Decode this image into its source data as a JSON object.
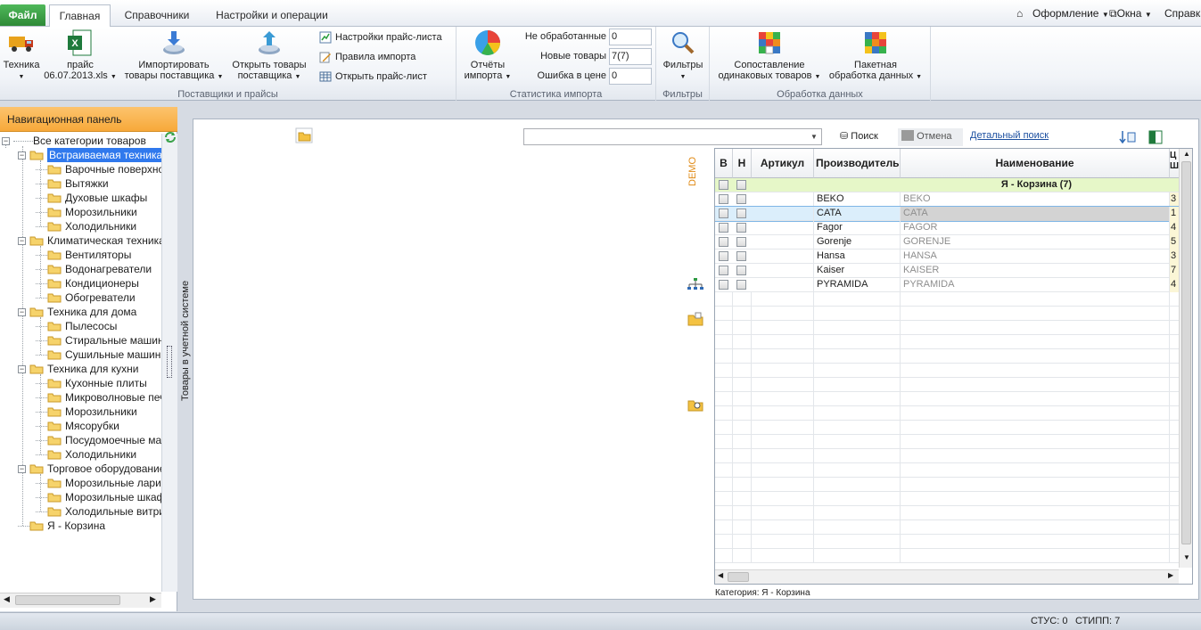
{
  "ribbon_tabs": {
    "file": "Файл",
    "home": "Главная",
    "refs": "Справочники",
    "settings": "Настройки и операции"
  },
  "ribbon_top_right": {
    "design": "Оформление",
    "windows": "Окна",
    "help": "Справка"
  },
  "ribbon": {
    "suppliers": {
      "label": "Поставщики и прайсы",
      "tech": "Техника",
      "price_line1": "прайс",
      "price_line2": "06.07.2013.xls",
      "import_line1": "Импортировать",
      "import_line2": "товары поставщика",
      "open_line1": "Открыть товары",
      "open_line2": "поставщика",
      "price_settings": "Настройки прайс-листа",
      "import_rules": "Правила импорта",
      "open_price": "Открыть прайс-лист"
    },
    "stats": {
      "label": "Статистика импорта",
      "reports_line1": "Отчёты",
      "reports_line2": "импорта",
      "not_processed_label": "Не обработанные",
      "not_processed_value": "0",
      "new_label": "Новые товары",
      "new_value": "7(7)",
      "errors_label": "Ошибка в цене",
      "errors_value": "0"
    },
    "filters": {
      "label": "Фильтры",
      "btn": "Фильтры"
    },
    "processing": {
      "label": "Обработка данных",
      "match_line1": "Сопоставление",
      "match_line2": "одинаковых товаров",
      "batch_line1": "Пакетная",
      "batch_line2": "обработка данных"
    }
  },
  "nav": {
    "title": "Навигационная панель",
    "root": "Все категории товаров",
    "items": [
      "Встраиваемая техника",
      "Варочные поверхности",
      "Вытяжки",
      "Духовые шкафы",
      "Морозильники",
      "Холодильники",
      "Климатическая техника",
      "Вентиляторы",
      "Водонагреватели",
      "Кондиционеры",
      "Обогреватели",
      "Техника для дома",
      "Пылесосы",
      "Стиральные машины",
      "Сушильные машины",
      "Техника для кухни",
      "Кухонные плиты",
      "Микроволновые печи",
      "Морозильники",
      "Мясорубки",
      "Посудомоечные машины",
      "Холодильники",
      "Торговое оборудование",
      "Морозильные лари",
      "Морозильные шкафы",
      "Холодильные витрины",
      "Я - Корзина"
    ]
  },
  "side_strip": "Товары в учетной системе",
  "main": {
    "search_btn": "Поиск",
    "cancel_btn": "Отмена",
    "detail_search": "Детальный поиск",
    "demo": "DEMO",
    "caption": "Категория: Я - Корзина"
  },
  "grid": {
    "headers": [
      "В",
      "Н",
      "Артикул",
      "Производитель",
      "Наименование",
      "Ц",
      "Ш"
    ],
    "group_row": "Я - Корзина (7)",
    "rows": [
      {
        "manufacturer": "BEKO",
        "name": "BEKO",
        "extra": "3"
      },
      {
        "manufacturer": "CATA",
        "name": "CATA",
        "extra": "1"
      },
      {
        "manufacturer": "Fagor",
        "name": "FAGOR",
        "extra": "4"
      },
      {
        "manufacturer": "Gorenje",
        "name": "GORENJE",
        "extra": "5"
      },
      {
        "manufacturer": "Hansa",
        "name": "HANSA",
        "extra": "3"
      },
      {
        "manufacturer": "Kaiser",
        "name": "KAISER",
        "extra": "7"
      },
      {
        "manufacturer": "PYRAMIDA",
        "name": "PYRAMIDA",
        "extra": "4"
      }
    ]
  },
  "status": {
    "stus": "СТУС: 0",
    "stipp": "СТИПП: 7"
  },
  "colors": {
    "nav_header": "#f7a93a",
    "selection": "#3079ed",
    "group_row": "#e6f7c8",
    "selected_row": "#dbeefb",
    "demo": "#e08b17"
  }
}
